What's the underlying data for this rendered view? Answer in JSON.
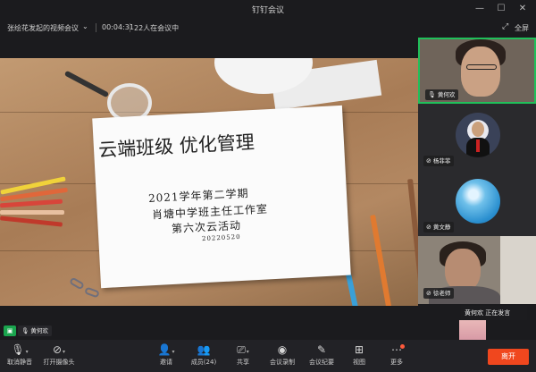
{
  "window": {
    "title": "钉钉会议",
    "minimize_glyph": "—",
    "maximize_glyph": "☐",
    "close_glyph": "✕"
  },
  "meeting_bar": {
    "meeting_name": "张绘花发起的视频会议",
    "timer": "00:04:31",
    "participant_count": "22人在会议中",
    "fullscreen_label": "全屏"
  },
  "slide": {
    "title": "云端班级  优化管理",
    "line1": "2021学年第二学期",
    "line2": "肖塘中学班主任工作室",
    "line3": "第六次云活动",
    "date": "20220520"
  },
  "participants": [
    {
      "name": "黄何欢",
      "muted": false,
      "accent": "#20c05a"
    },
    {
      "name": "杨菲菲",
      "muted": true
    },
    {
      "name": "黄文静",
      "muted": true
    },
    {
      "name": "徐老师",
      "muted": true
    }
  ],
  "speaking_indicator": {
    "name": "黄何欢",
    "status": "正在发言"
  },
  "self_tag": {
    "name": "黄何欢"
  },
  "toolbar": {
    "mute": {
      "label": "取消静音",
      "icon": "mic-muted-icon"
    },
    "camera": {
      "label": "打开摄像头",
      "icon": "camera-off-icon"
    },
    "invite": {
      "label": "邀请",
      "icon": "add-person-icon"
    },
    "members": {
      "label": "成员(24)",
      "icon": "members-icon"
    },
    "share": {
      "label": "共享",
      "icon": "share-screen-icon"
    },
    "record": {
      "label": "会议录制",
      "icon": "record-icon"
    },
    "minutes": {
      "label": "会议纪要",
      "icon": "minutes-icon"
    },
    "view": {
      "label": "视图",
      "icon": "grid-view-icon"
    },
    "more": {
      "label": "更多",
      "icon": "more-icon"
    },
    "leave": {
      "label": "离开",
      "color": "#f0471e"
    }
  }
}
